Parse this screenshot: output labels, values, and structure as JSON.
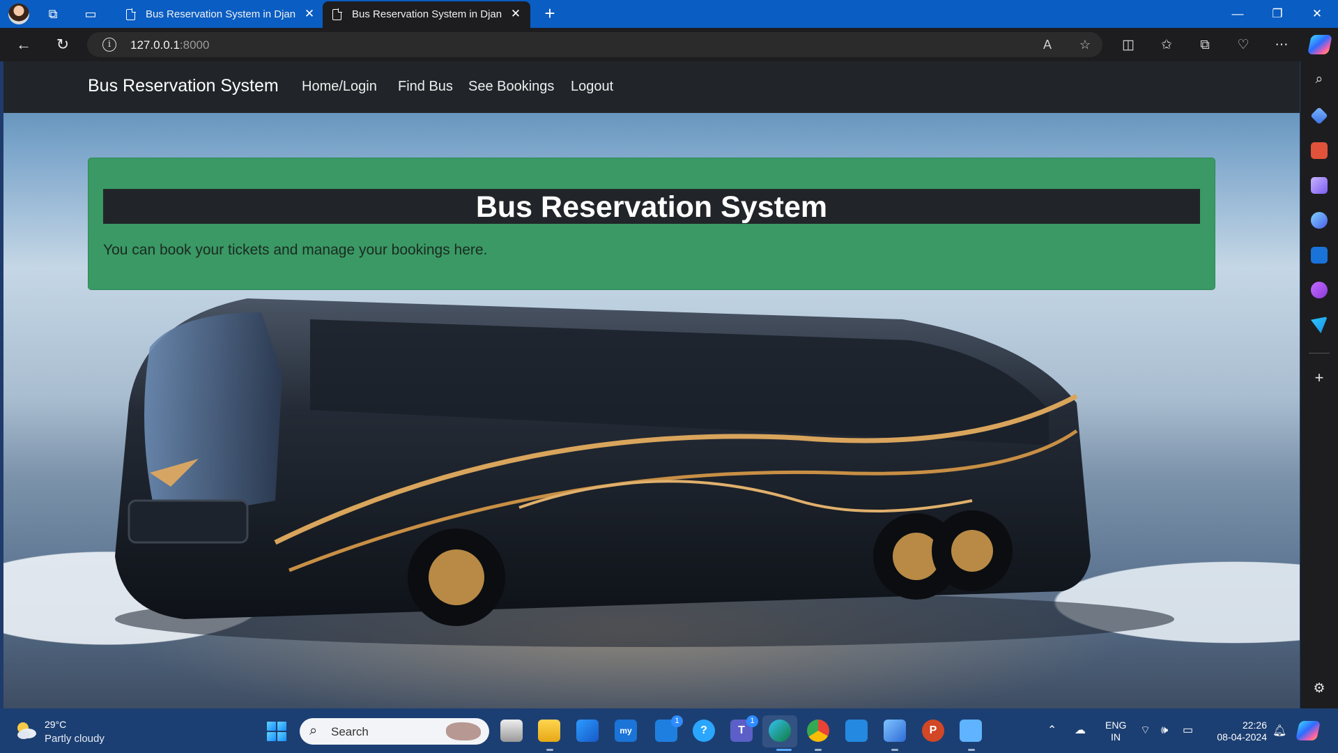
{
  "browser": {
    "tabs": [
      {
        "title": "Bus Reservation System in Django"
      },
      {
        "title": "Bus Reservation System in Django"
      }
    ],
    "address": {
      "host": "127.0.0.1",
      "port": ":8000"
    }
  },
  "site": {
    "brand": "Bus Reservation System",
    "nav": {
      "home_login": "Home/Login",
      "find_bus": "Find Bus",
      "see_bookings": "See Bookings",
      "logout": "Logout"
    },
    "hero": {
      "title": "Bus Reservation System",
      "subtitle": "You can book your tickets and manage your bookings here."
    },
    "colors": {
      "navbar": "#212529",
      "hero": "#3a9964",
      "hero_title_bg": "#212529"
    }
  },
  "taskbar": {
    "weather": {
      "temp": "29°C",
      "desc": "Partly cloudy"
    },
    "search_placeholder": "Search",
    "badges": {
      "mail": "1",
      "teams": "1"
    },
    "tray": {
      "lang_top": "ENG",
      "lang_bottom": "IN",
      "time": "22:26",
      "date": "08-04-2024"
    }
  }
}
